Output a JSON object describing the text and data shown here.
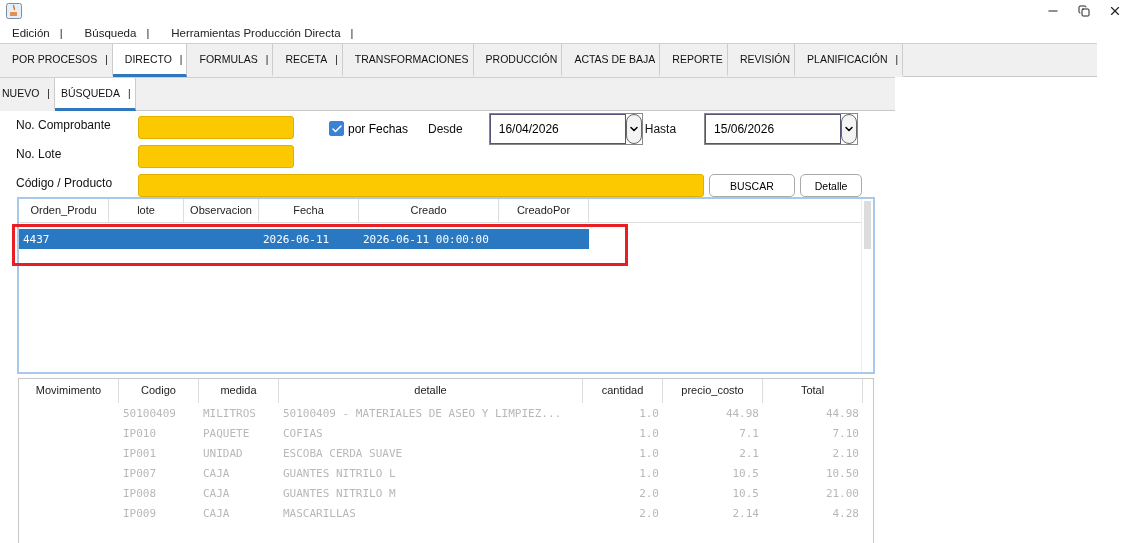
{
  "menu": [
    {
      "label": "Edición",
      "bar": "|"
    },
    {
      "label": "Búsqueda",
      "bar": "|"
    },
    {
      "label": "Herramientas Producción Directa",
      "bar": "|"
    }
  ],
  "tabs": [
    {
      "label": "POR PROCESOS",
      "bar": "|",
      "selected": false
    },
    {
      "label": "DIRECTO",
      "bar": "|",
      "selected": true
    },
    {
      "label": "FORMULAS",
      "bar": "|",
      "selected": false
    },
    {
      "label": "RECETA",
      "bar": "|",
      "selected": false
    },
    {
      "label": "TRANSFORMACIONES",
      "selected": false
    },
    {
      "label": "PRODUCCIÓN",
      "selected": false
    },
    {
      "label": "ACTAS DE BAJA",
      "selected": false
    },
    {
      "label": "REPORTE",
      "selected": false
    },
    {
      "label": "REVISIÓN",
      "selected": false
    },
    {
      "label": "PLANIFICACIÓN",
      "bar": "|",
      "selected": false
    }
  ],
  "subtabs": [
    {
      "label": "NUEVO",
      "bar": "|",
      "selected": false
    },
    {
      "label": "BÚSQUEDA",
      "bar": "|",
      "selected": true
    }
  ],
  "form": {
    "comprobante_label": "No. Comprobante",
    "lote_label": "No. Lote",
    "producto_label": "Código / Producto",
    "por_fechas": {
      "label": "por Fechas",
      "checked": true
    },
    "desde_label": "Desde",
    "desde": "16/04/2026",
    "hasta_label": "Hasta",
    "hasta": "15/06/2026",
    "buttons": [
      "BUSCAR",
      "Detalle"
    ]
  },
  "orders_table": {
    "columns": [
      "Orden_Produ",
      "lote",
      "Observacion",
      "Fecha",
      "Creado",
      "CreadoPor"
    ],
    "rows": [
      {
        "cells": [
          "4437",
          "",
          "",
          "2026-06-11",
          "2026-06-11 00:00:00",
          ""
        ],
        "selected": true
      }
    ]
  },
  "items_table": {
    "columns": [
      "Movimimento",
      "Codigo",
      "medida",
      "detalle",
      "cantidad",
      "precio_costo",
      "Total"
    ],
    "rows": [
      {
        "cells": [
          "",
          "50100409",
          "MILITROS",
          "50100409 - MATERIALES DE ASEO Y LIMPIEZ...",
          "1.0",
          "44.98",
          "44.98"
        ]
      },
      {
        "cells": [
          "",
          "IP010",
          "PAQUETE",
          "COFIAS",
          "1.0",
          "7.1",
          "7.10"
        ]
      },
      {
        "cells": [
          "",
          "IP001",
          "UNIDAD",
          "ESCOBA CERDA SUAVE",
          "1.0",
          "2.1",
          "2.10"
        ]
      },
      {
        "cells": [
          "",
          "IP007",
          "CAJA",
          "GUANTES NITRILO L",
          "1.0",
          "10.5",
          "10.50"
        ]
      },
      {
        "cells": [
          "",
          "IP008",
          "CAJA",
          "GUANTES NITRILO M",
          "2.0",
          "10.5",
          "21.00"
        ]
      },
      {
        "cells": [
          "",
          "IP009",
          "CAJA",
          "MASCARILLAS",
          "2.0",
          "2.14",
          "4.28"
        ]
      }
    ]
  }
}
